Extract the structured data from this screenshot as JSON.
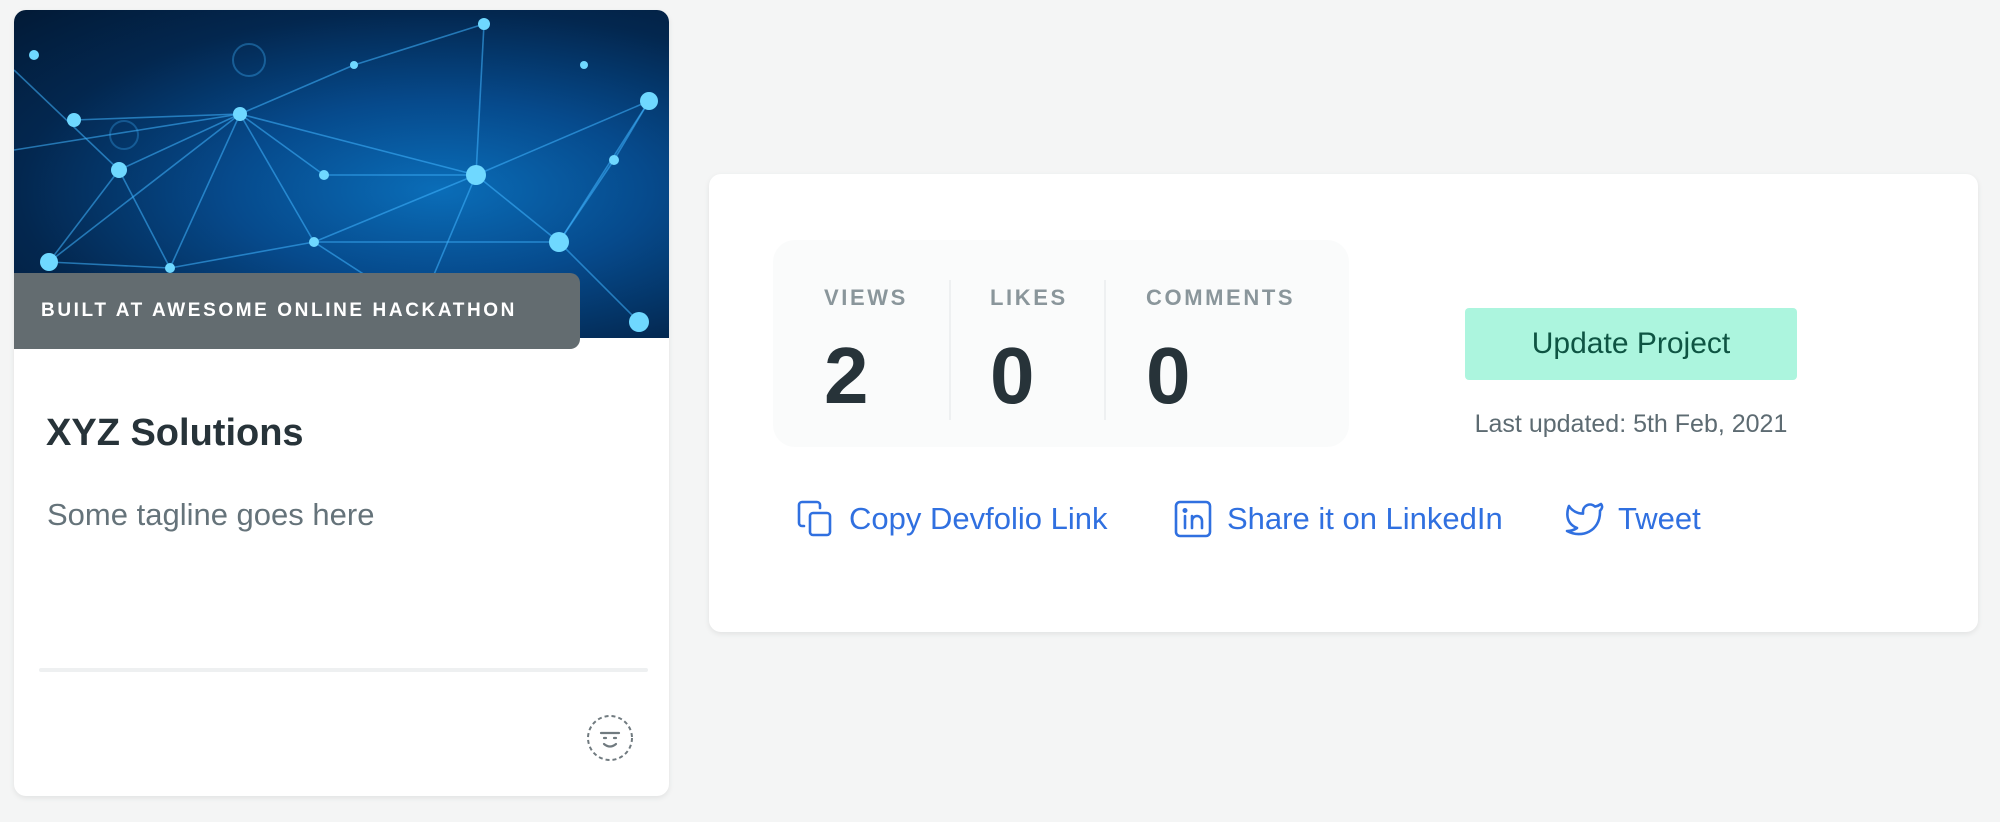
{
  "project_card": {
    "badge": "BUILT AT AWESOME ONLINE HACKATHON",
    "title": "XYZ Solutions",
    "tagline": "Some tagline goes here",
    "cover_icon": "network-graph-image",
    "avatar_icon": "face-avatar-icon"
  },
  "stats": [
    {
      "label": "VIEWS",
      "value": "2"
    },
    {
      "label": "LIKES",
      "value": "0"
    },
    {
      "label": "COMMENTS",
      "value": "0"
    }
  ],
  "actions": {
    "update_label": "Update Project",
    "last_updated": "Last updated: 5th Feb, 2021"
  },
  "share_links": [
    {
      "label": "Copy Devfolio Link",
      "icon": "copy-icon"
    },
    {
      "label": "Share it on LinkedIn",
      "icon": "linkedin-icon"
    },
    {
      "label": "Tweet",
      "icon": "twitter-icon"
    }
  ],
  "colors": {
    "page_background": "#f4f5f5",
    "accent_link": "#3070e0",
    "update_button_bg": "#acf5de",
    "update_button_text": "#0e5443",
    "badge_bg": "#636c70"
  }
}
